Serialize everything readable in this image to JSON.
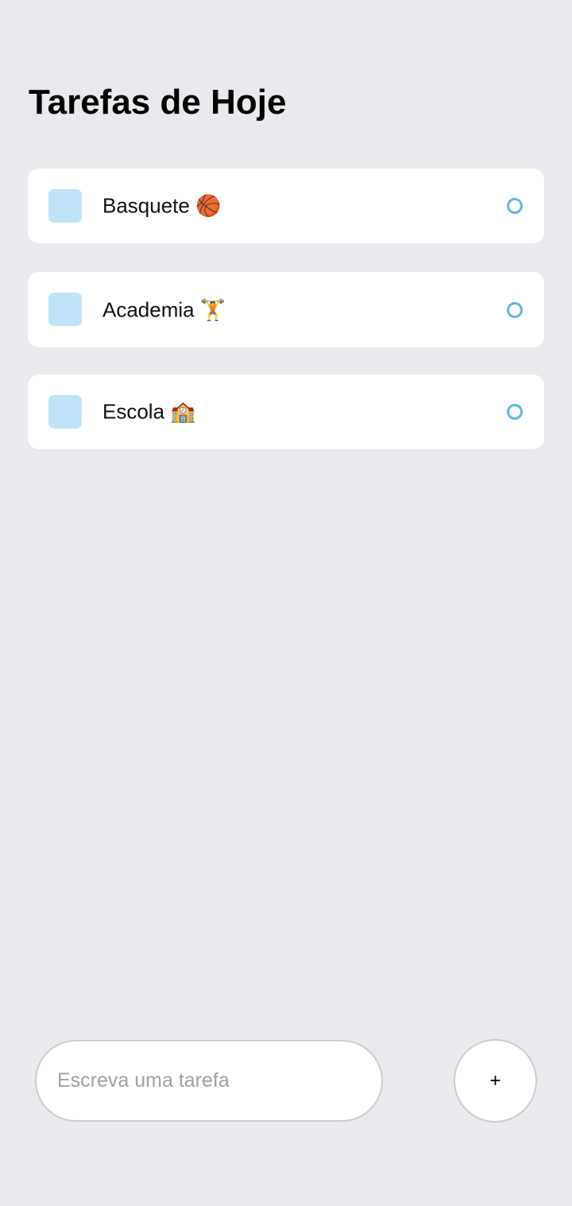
{
  "header": {
    "title": "Tarefas de Hoje"
  },
  "tasks": [
    {
      "label": "Basquete 🏀"
    },
    {
      "label": "Academia 🏋️"
    },
    {
      "label": "Escola 🏫"
    }
  ],
  "composer": {
    "placeholder": "Escreva uma tarefa",
    "value": "",
    "add_label": "+"
  },
  "colors": {
    "background": "#E8EAED",
    "card": "#FFFFFF",
    "square": "#BFE3F8",
    "circle": "#5FB8E3"
  }
}
